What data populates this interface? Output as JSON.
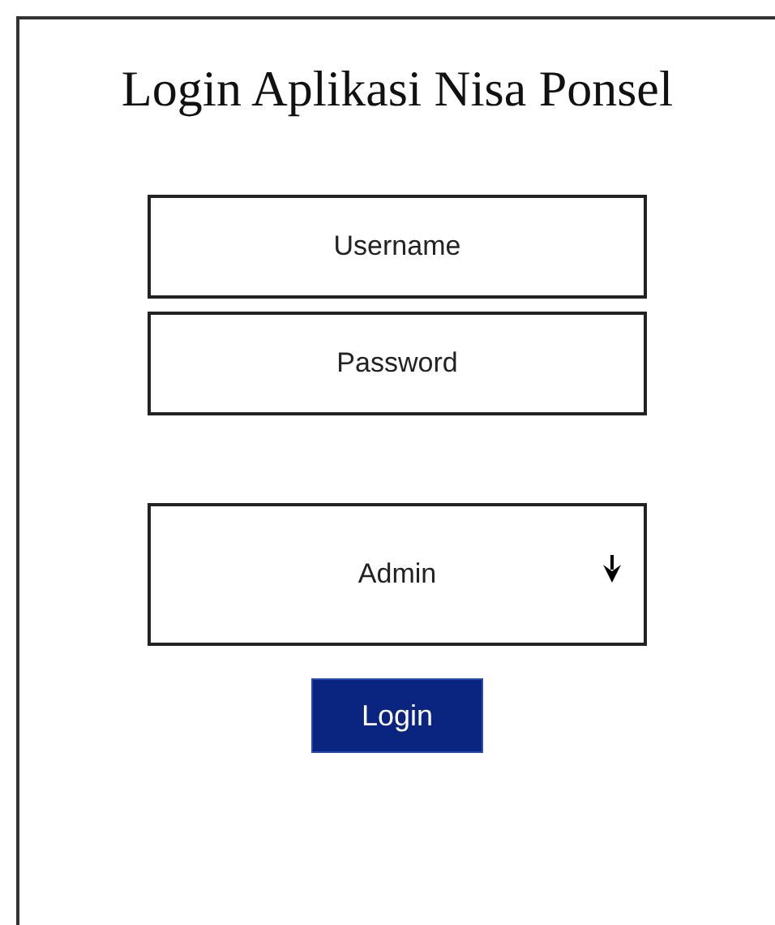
{
  "title": "Login Aplikasi Nisa Ponsel",
  "fields": [
    {
      "placeholder": "Username"
    },
    {
      "placeholder": "Password"
    }
  ],
  "role_select": {
    "value": "Admin"
  },
  "login_button": {
    "label": "Login"
  }
}
